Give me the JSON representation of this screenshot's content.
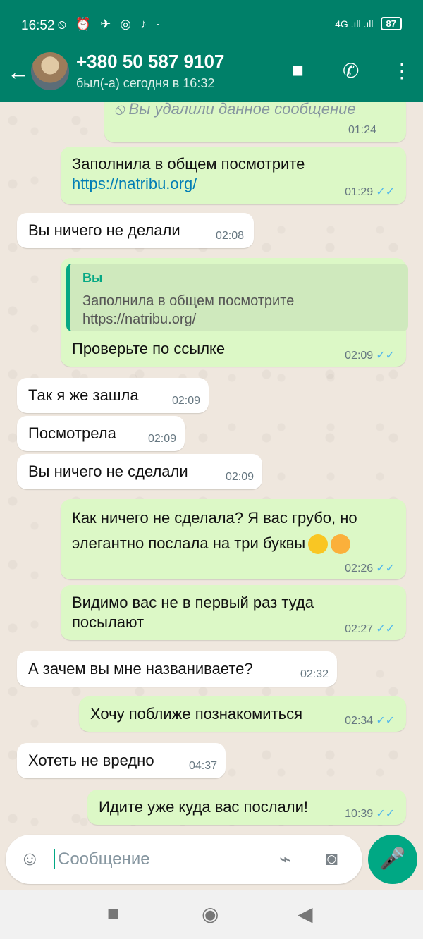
{
  "status": {
    "time": "16:52",
    "icons": "⦸ ⏰ ✈ ◎ ♪ ·",
    "network": "4G .ıll .ıll",
    "battery": "87"
  },
  "header": {
    "back": "←",
    "name": "+380 50 587 9107",
    "last_seen": "был(-а) сегодня в 16:32",
    "video": "■",
    "call": "✆",
    "menu": "⋮"
  },
  "messages": [
    {
      "deleted": "Вы удалили данное сообщение",
      "time": "01:24"
    },
    {
      "line1": "Заполнила в общем посмотрите",
      "link": "https://natribu.org/",
      "time": "01:29"
    },
    {
      "text": "Вы ничего не делали",
      "time": "02:08"
    },
    {
      "quote_name": "Вы",
      "quote_line1": "Заполнила в общем посмотрите",
      "quote_line2": "https://natribu.org/",
      "text": "Проверьте по ссылке",
      "time": "02:09"
    },
    {
      "text": "Так я же зашла",
      "time": "02:09"
    },
    {
      "text": "Посмотрела",
      "time": "02:09"
    },
    {
      "text": "Вы ничего не сделали",
      "time": "02:09"
    },
    {
      "line1": "Как ничего не сделала? Я вас грубо, но",
      "line2": "элегантно послала на три буквы",
      "time": "02:26"
    },
    {
      "line1": "Видимо вас не в первый раз туда",
      "line2": "посылают",
      "time": "02:27"
    },
    {
      "text": "А зачем вы мне названиваете?",
      "time": "02:32"
    },
    {
      "text": "Хочу поближе познакомиться",
      "time": "02:34"
    },
    {
      "text": "Хотеть не вредно",
      "time": "04:37"
    },
    {
      "text": "Идите уже куда вас послали!",
      "time": "10:39"
    }
  ],
  "ticks": "✓✓",
  "input": {
    "placeholder": "Сообщение",
    "emoji": "☺",
    "attach": "⌁",
    "camera": "◙",
    "mic": "🎤"
  },
  "navbar": {
    "recents": "■",
    "home": "◉",
    "back": "◀"
  }
}
